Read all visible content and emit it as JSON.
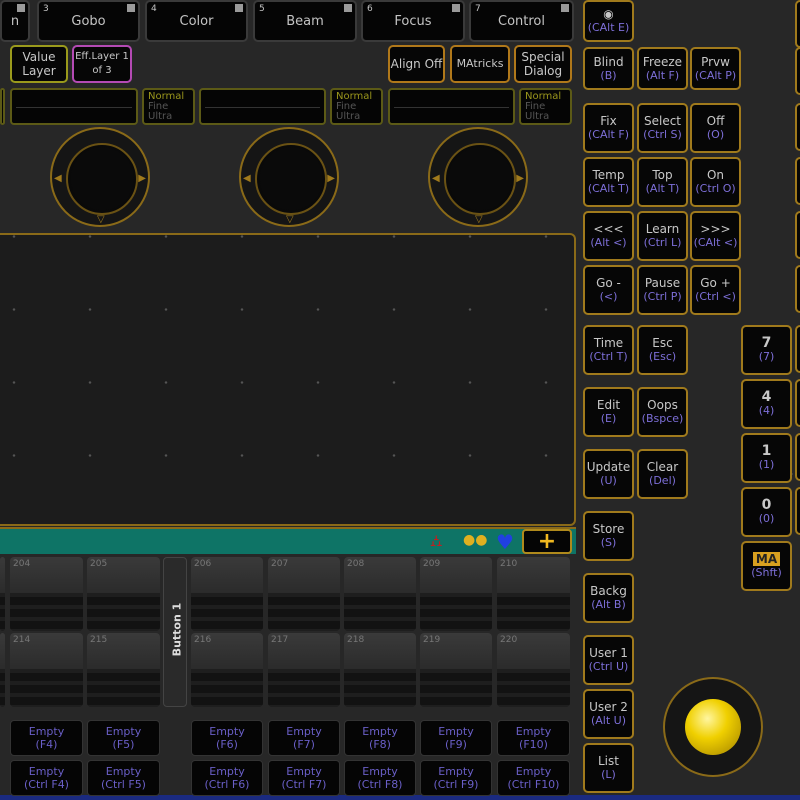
{
  "preset_tabs": [
    {
      "num": "",
      "label": "n"
    },
    {
      "num": "3",
      "label": "Gobo"
    },
    {
      "num": "4",
      "label": "Color"
    },
    {
      "num": "5",
      "label": "Beam"
    },
    {
      "num": "6",
      "label": "Focus"
    },
    {
      "num": "7",
      "label": "Control"
    }
  ],
  "layer_buttons": {
    "value_layer": "Value Layer",
    "eff_layer": "Eff.Layer 1 of 3",
    "align": "Align Off",
    "matricks": "MAtricks",
    "special": "Special Dialog"
  },
  "encoder_modes": {
    "normal": "Normal",
    "fine": "Fine",
    "ultra": "Ultra"
  },
  "colors": {
    "accent": "#a07a1c",
    "key_hint": "#7d6fd8",
    "teal_bar": "#0e7466",
    "magenta": "#b44ab4",
    "trackball": "#f0d000"
  },
  "toolbar_icons": [
    "network-icon",
    "fixture-icon",
    "heart-icon",
    "plus-icon"
  ],
  "executors": {
    "row1": [
      "",
      "204",
      "205",
      "206",
      "207",
      "208",
      "209",
      "210"
    ],
    "row2": [
      "",
      "214",
      "215",
      "216",
      "217",
      "218",
      "219",
      "220"
    ],
    "button_label": "Button 1"
  },
  "fkeys": {
    "row1": [
      [
        "Empty",
        "(F4)"
      ],
      [
        "Empty",
        "(F5)"
      ],
      [
        "Empty",
        "(F6)"
      ],
      [
        "Empty",
        "(F7)"
      ],
      [
        "Empty",
        "(F8)"
      ],
      [
        "Empty",
        "(F9)"
      ],
      [
        "Empty",
        "(F10)"
      ]
    ],
    "row2": [
      [
        "Empty",
        "(Ctrl F4)"
      ],
      [
        "Empty",
        "(Ctrl F5)"
      ],
      [
        "Empty",
        "(Ctrl F6)"
      ],
      [
        "Empty",
        "(Ctrl F7)"
      ],
      [
        "Empty",
        "(Ctrl F8)"
      ],
      [
        "Empty",
        "(Ctrl F9)"
      ],
      [
        "Empty",
        "(Ctrl F10)"
      ]
    ]
  },
  "keys": [
    {
      "l": "◉",
      "k": "(CAlt E)"
    },
    {
      "l": "Blind",
      "k": "(B)"
    },
    {
      "l": "Freeze",
      "k": "(Alt F)"
    },
    {
      "l": "Prvw",
      "k": "(CAlt P)"
    },
    {
      "l": "Fix",
      "k": "(CAlt F)"
    },
    {
      "l": "Select",
      "k": "(Ctrl S)"
    },
    {
      "l": "Off",
      "k": "(O)"
    },
    {
      "l": "Temp",
      "k": "(CAlt T)"
    },
    {
      "l": "Top",
      "k": "(Alt T)"
    },
    {
      "l": "On",
      "k": "(Ctrl O)"
    },
    {
      "l": "<<<",
      "k": "(Alt <)"
    },
    {
      "l": "Learn",
      "k": "(Ctrl L)"
    },
    {
      "l": ">>>",
      "k": "(CAlt <)"
    },
    {
      "l": "Go -",
      "k": "(<)"
    },
    {
      "l": "Pause",
      "k": "(Ctrl P)"
    },
    {
      "l": "Go +",
      "k": "(Ctrl <)"
    },
    {
      "l": "Time",
      "k": "(Ctrl T)"
    },
    {
      "l": "Esc",
      "k": "(Esc)"
    },
    {
      "l": "Edit",
      "k": "(E)"
    },
    {
      "l": "Oops",
      "k": "(Bspce)"
    },
    {
      "l": "Update",
      "k": "(U)"
    },
    {
      "l": "Clear",
      "k": "(Del)"
    },
    {
      "l": "Store",
      "k": "(S)"
    },
    {
      "l": "Backg",
      "k": "(Alt B)"
    },
    {
      "l": "User 1",
      "k": "(Ctrl U)"
    },
    {
      "l": "User 2",
      "k": "(Alt U)"
    },
    {
      "l": "List",
      "k": "(L)"
    }
  ],
  "numpad": [
    {
      "l": "7",
      "k": "(7)"
    },
    {
      "l": "4",
      "k": "(4)"
    },
    {
      "l": "1",
      "k": "(1)"
    },
    {
      "l": "0",
      "k": "(0)"
    },
    {
      "l": "MA",
      "k": "(Shft)"
    }
  ]
}
